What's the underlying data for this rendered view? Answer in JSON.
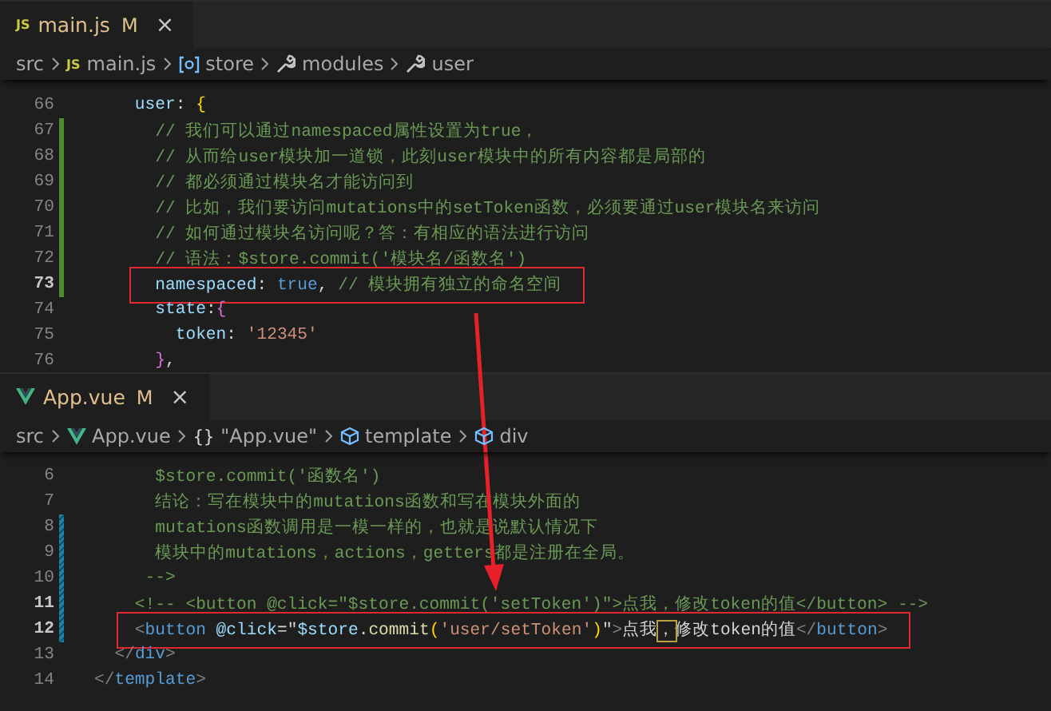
{
  "editors": [
    {
      "tab": {
        "kind": "js",
        "icon_text": "JS",
        "filename": "main.js",
        "status": "M",
        "close": "×"
      },
      "breadcrumb": [
        {
          "kind": "folder",
          "label": "src"
        },
        {
          "kind": "js",
          "icon_text": "JS",
          "label": "main.js"
        },
        {
          "kind": "variable",
          "label": "store"
        },
        {
          "kind": "wrench",
          "label": "modules"
        },
        {
          "kind": "wrench",
          "label": "user"
        }
      ],
      "lines": [
        {
          "number": "66",
          "current": false,
          "added": false,
          "modified": false,
          "boxed": false,
          "tokens": [
            {
              "kind": "key",
              "text": "    user"
            },
            {
              "kind": "plain",
              "text": ": "
            },
            {
              "kind": "brace",
              "text": "{"
            }
          ]
        },
        {
          "number": "67",
          "current": false,
          "added": true,
          "modified": false,
          "boxed": false,
          "tokens": [
            {
              "kind": "comment",
              "text": "      // 我们可以通过namespaced属性设置为true，"
            }
          ]
        },
        {
          "number": "68",
          "current": false,
          "added": true,
          "modified": false,
          "boxed": false,
          "tokens": [
            {
              "kind": "comment",
              "text": "      // 从而给user模块加一道锁，此刻user模块中的所有内容都是局部的"
            }
          ]
        },
        {
          "number": "69",
          "current": false,
          "added": true,
          "modified": false,
          "boxed": false,
          "tokens": [
            {
              "kind": "comment",
              "text": "      // 都必须通过模块名才能访问到"
            }
          ]
        },
        {
          "number": "70",
          "current": false,
          "added": true,
          "modified": false,
          "boxed": false,
          "tokens": [
            {
              "kind": "comment",
              "text": "      // 比如，我们要访问mutations中的setToken函数，必须要通过user模块名来访问"
            }
          ]
        },
        {
          "number": "71",
          "current": false,
          "added": true,
          "modified": false,
          "boxed": false,
          "tokens": [
            {
              "kind": "comment",
              "text": "      // 如何通过模块名访问呢？答：有相应的语法进行访问"
            }
          ]
        },
        {
          "number": "72",
          "current": false,
          "added": true,
          "modified": false,
          "boxed": false,
          "tokens": [
            {
              "kind": "comment",
              "text": "      // 语法：$store.commit('模块名/函数名')"
            }
          ]
        },
        {
          "number": "73",
          "current": true,
          "added": true,
          "modified": false,
          "boxed": true,
          "tokens": [
            {
              "kind": "key",
              "text": "      namespaced"
            },
            {
              "kind": "plain",
              "text": ": "
            },
            {
              "kind": "keyword",
              "text": "true"
            },
            {
              "kind": "plain",
              "text": ", "
            },
            {
              "kind": "comment",
              "text": "// 模块拥有独立的命名空间"
            }
          ]
        },
        {
          "number": "74",
          "current": false,
          "added": false,
          "modified": false,
          "boxed": false,
          "tokens": [
            {
              "kind": "key",
              "text": "      state"
            },
            {
              "kind": "plain",
              "text": ":"
            },
            {
              "kind": "brace2",
              "text": "{"
            }
          ]
        },
        {
          "number": "75",
          "current": false,
          "added": false,
          "modified": false,
          "boxed": false,
          "tokens": [
            {
              "kind": "key",
              "text": "        token"
            },
            {
              "kind": "plain",
              "text": ": "
            },
            {
              "kind": "string",
              "text": "'12345'"
            }
          ]
        },
        {
          "number": "76",
          "current": false,
          "added": false,
          "modified": false,
          "boxed": false,
          "tokens": [
            {
              "kind": "brace2",
              "text": "      }"
            },
            {
              "kind": "plain",
              "text": ","
            }
          ]
        }
      ]
    },
    {
      "tab": {
        "kind": "vue",
        "filename": "App.vue",
        "status": "M",
        "close": "×"
      },
      "breadcrumb": [
        {
          "kind": "folder",
          "label": "src"
        },
        {
          "kind": "vue",
          "label": "App.vue"
        },
        {
          "kind": "object",
          "icon_text": "{}",
          "label": "\"App.vue\""
        },
        {
          "kind": "element",
          "label": "template"
        },
        {
          "kind": "element",
          "label": "div"
        }
      ],
      "lines": [
        {
          "number": "6",
          "current": false,
          "added": false,
          "modified": false,
          "boxed": false,
          "tokens": [
            {
              "kind": "comment",
              "text": "      $store.commit('函数名')"
            }
          ]
        },
        {
          "number": "7",
          "current": false,
          "added": false,
          "modified": false,
          "boxed": false,
          "tokens": [
            {
              "kind": "comment",
              "text": "      结论：写在模块中的mutations函数和写在模块外面的"
            }
          ]
        },
        {
          "number": "8",
          "current": false,
          "added": false,
          "modified": true,
          "boxed": false,
          "tokens": [
            {
              "kind": "comment",
              "text": "      mutations函数调用是一模一样的，也就是说默认情况下"
            }
          ]
        },
        {
          "number": "9",
          "current": false,
          "added": false,
          "modified": true,
          "boxed": false,
          "tokens": [
            {
              "kind": "comment",
              "text": "      模块中的mutations，actions，getters都是注册在全局。"
            }
          ]
        },
        {
          "number": "10",
          "current": false,
          "added": false,
          "modified": true,
          "boxed": false,
          "tokens": [
            {
              "kind": "comment",
              "text": "     -->"
            }
          ]
        },
        {
          "number": "11",
          "current": true,
          "added": false,
          "modified": true,
          "boxed": false,
          "tokens": [
            {
              "kind": "comment",
              "text": "    <!-- <button @click=\"$store.commit('setToken')\">点我，修改token的值</button> -->"
            }
          ]
        },
        {
          "number": "12",
          "current": true,
          "added": false,
          "modified": true,
          "boxed": true,
          "tokens": [
            {
              "kind": "bracket",
              "text": "    <"
            },
            {
              "kind": "tag",
              "text": "button"
            },
            {
              "kind": "key",
              "text": " @click"
            },
            {
              "kind": "plain",
              "text": "=\""
            },
            {
              "kind": "key",
              "text": "$store"
            },
            {
              "kind": "plain",
              "text": "."
            },
            {
              "kind": "function",
              "text": "commit"
            },
            {
              "kind": "brace",
              "text": "("
            },
            {
              "kind": "string",
              "text": "'user/setToken'"
            },
            {
              "kind": "brace",
              "text": ")"
            },
            {
              "kind": "plain",
              "text": "\""
            },
            {
              "kind": "bracket",
              "text": ">"
            },
            {
              "kind": "plain",
              "text": "点我"
            },
            {
              "kind": "match",
              "text": "，"
            },
            {
              "kind": "plain",
              "text": "修改token的值"
            },
            {
              "kind": "bracket",
              "text": "</"
            },
            {
              "kind": "tag",
              "text": "button"
            },
            {
              "kind": "bracket",
              "text": ">"
            }
          ]
        },
        {
          "number": "13",
          "current": false,
          "added": false,
          "modified": false,
          "boxed": false,
          "tokens": [
            {
              "kind": "bracket",
              "text": "  </"
            },
            {
              "kind": "tag",
              "text": "div"
            },
            {
              "kind": "bracket",
              "text": ">"
            }
          ]
        },
        {
          "number": "14",
          "current": false,
          "added": false,
          "modified": false,
          "boxed": false,
          "tokens": [
            {
              "kind": "bracket",
              "text": "</"
            },
            {
              "kind": "tag",
              "text": "template"
            },
            {
              "kind": "bracket",
              "text": ">"
            }
          ]
        }
      ]
    }
  ]
}
